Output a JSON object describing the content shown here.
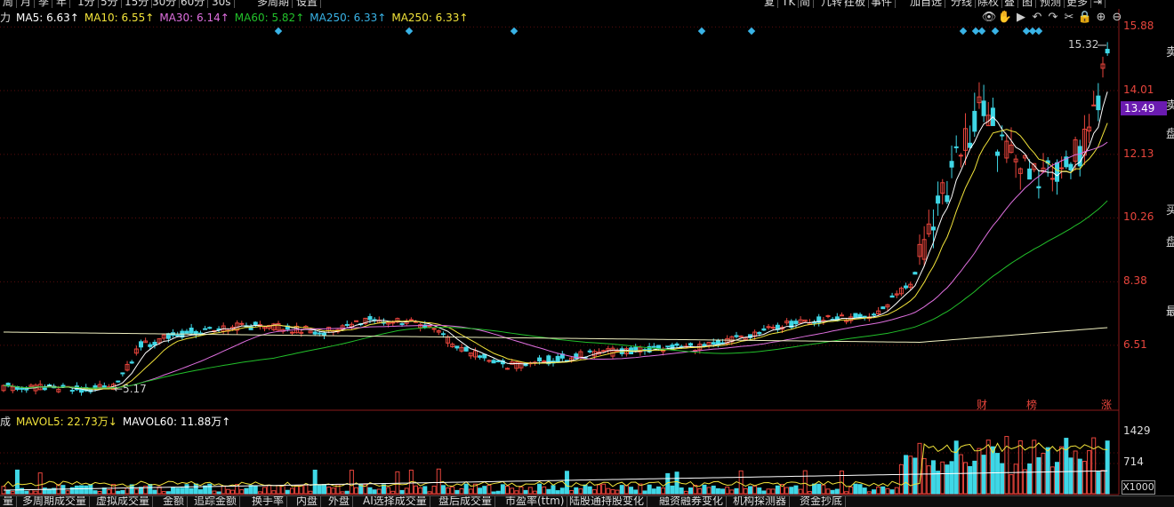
{
  "toolbar": {
    "items": [
      "周",
      "月",
      "季",
      "年",
      "1分",
      "5分",
      "15分",
      "30分",
      "60分",
      "30s",
      "多周期",
      "设置"
    ],
    "right_items": [
      "复",
      "TK",
      "简",
      "几转",
      "在板",
      "事件",
      "加自选",
      "分线",
      "除权",
      "叠",
      "图",
      "预测",
      "更多",
      "⇥"
    ]
  },
  "ma_legend": {
    "prefix": "力",
    "items": [
      {
        "label": "MA5: 6.63↑",
        "color": "#ffffff"
      },
      {
        "label": "MA10: 6.55↑",
        "color": "#f2e33a"
      },
      {
        "label": "MA30: 6.14↑",
        "color": "#e070e0"
      },
      {
        "label": "MA60: 5.82↑",
        "color": "#22c02a"
      },
      {
        "label": "MA250: 6.33↑",
        "color": "#39b3e6"
      },
      {
        "label": "MA250: 6.33↑",
        "color": "#f2e33a"
      }
    ]
  },
  "tools": [
    "eye-icon",
    "hand-icon",
    "play-icon",
    "undo-icon",
    "redo-icon",
    "scissors-icon",
    "lock-icon",
    "zoom-in-icon",
    "zoom-out-icon"
  ],
  "tool_glyphs": [
    "👁",
    "✋",
    "▶",
    "↶",
    "↷",
    "✂",
    "🔒",
    "⊕",
    "⊖"
  ],
  "price_axis": {
    "labels": [
      "15.88",
      "14.01",
      "12.13",
      "10.26",
      "8.38",
      "6.51"
    ],
    "current": "13.49",
    "high": "15.32",
    "low": "5.17"
  },
  "right_glyphs": [
    "卖",
    "卖",
    "盘",
    "买",
    "盘",
    "最"
  ],
  "markers": [
    "财",
    "榜",
    "涨"
  ],
  "vol_legend": {
    "prefix": "成",
    "items": [
      {
        "label": "MAVOL5: 22.73万↓",
        "color": "#f2e33a"
      },
      {
        "label": "MAVOL60: 11.88万↑",
        "color": "#ffffff"
      }
    ]
  },
  "vol_axis": {
    "labels": [
      "1429",
      "714"
    ],
    "scale": "X1000"
  },
  "bottom_tabs": [
    "量",
    "多周期成交量",
    "虚拟成交量",
    "金额",
    "追踪金额",
    "换手率",
    "内盘",
    "外盘",
    "AI选择成交量",
    "盘后成交量",
    "市盈率(ttm)",
    "陆股通持股变化",
    "融资融券变化",
    "机构探测器",
    "资金抄底"
  ],
  "colors": {
    "up": "#e8453c",
    "down": "#3fd7e6",
    "grid": "#5a0d0d",
    "ma5": "#ffffff",
    "ma10": "#f2e33a",
    "ma30": "#e070e0",
    "ma60": "#22c02a",
    "ma250": "#f0f0c0"
  },
  "chart_data": {
    "type": "candlestick",
    "ylim": [
      4.6,
      16.1
    ],
    "ticks": [
      15.88,
      14.01,
      12.13,
      10.26,
      8.38,
      6.51
    ],
    "high": 15.32,
    "low": 5.17,
    "current": 13.49
  }
}
